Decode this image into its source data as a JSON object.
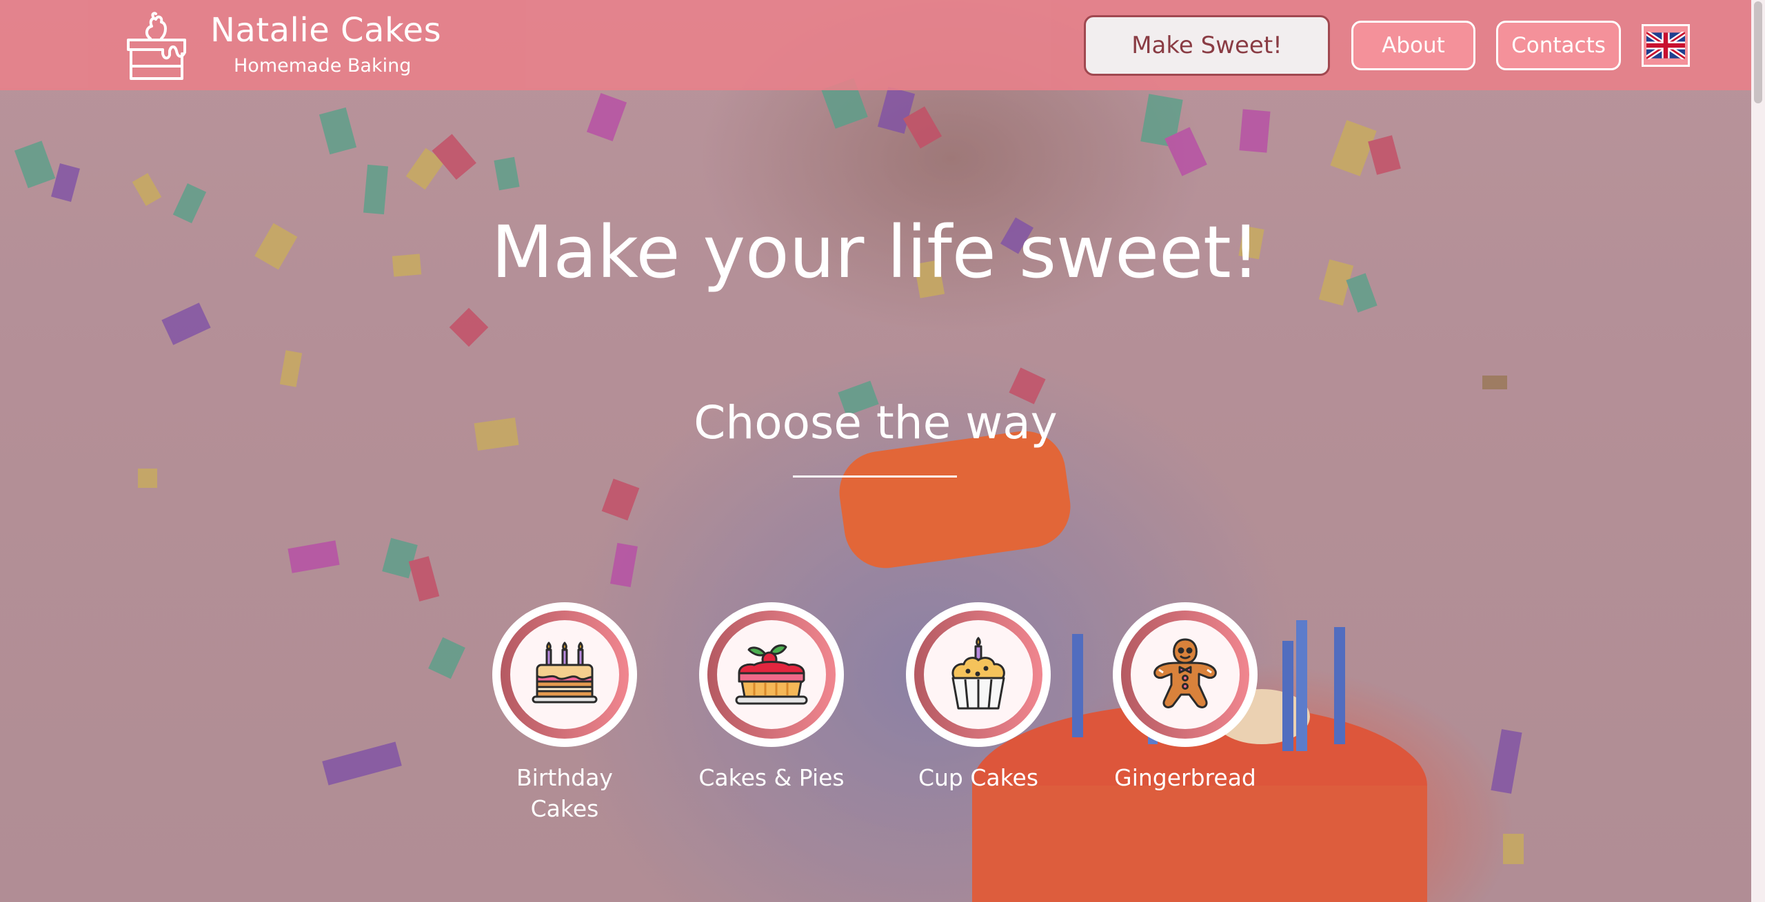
{
  "header": {
    "brand_name": "Natalie Cakes",
    "brand_tagline": "Homemade Baking",
    "logo_icon": "cake-logo-icon",
    "cta_label": "Make Sweet!",
    "nav": {
      "about_label": "About",
      "contacts_label": "Contacts"
    },
    "language_icon": "uk-flag-icon"
  },
  "hero": {
    "title": "Make your life sweet!",
    "subtitle": "Choose the way"
  },
  "categories": [
    {
      "label": "Birthday Cakes",
      "icon": "birthday-cake-icon"
    },
    {
      "label": "Cakes & Pies",
      "icon": "cake-pie-icon"
    },
    {
      "label": "Cup Cakes",
      "icon": "cupcake-icon"
    },
    {
      "label": "Gingerbread",
      "icon": "gingerbread-icon"
    }
  ],
  "colors": {
    "header_bg": "#e9808a",
    "accent": "#f4919a",
    "cta_border": "#a04850",
    "ring_dark": "#b55a62",
    "ring_light": "#f0868f"
  }
}
